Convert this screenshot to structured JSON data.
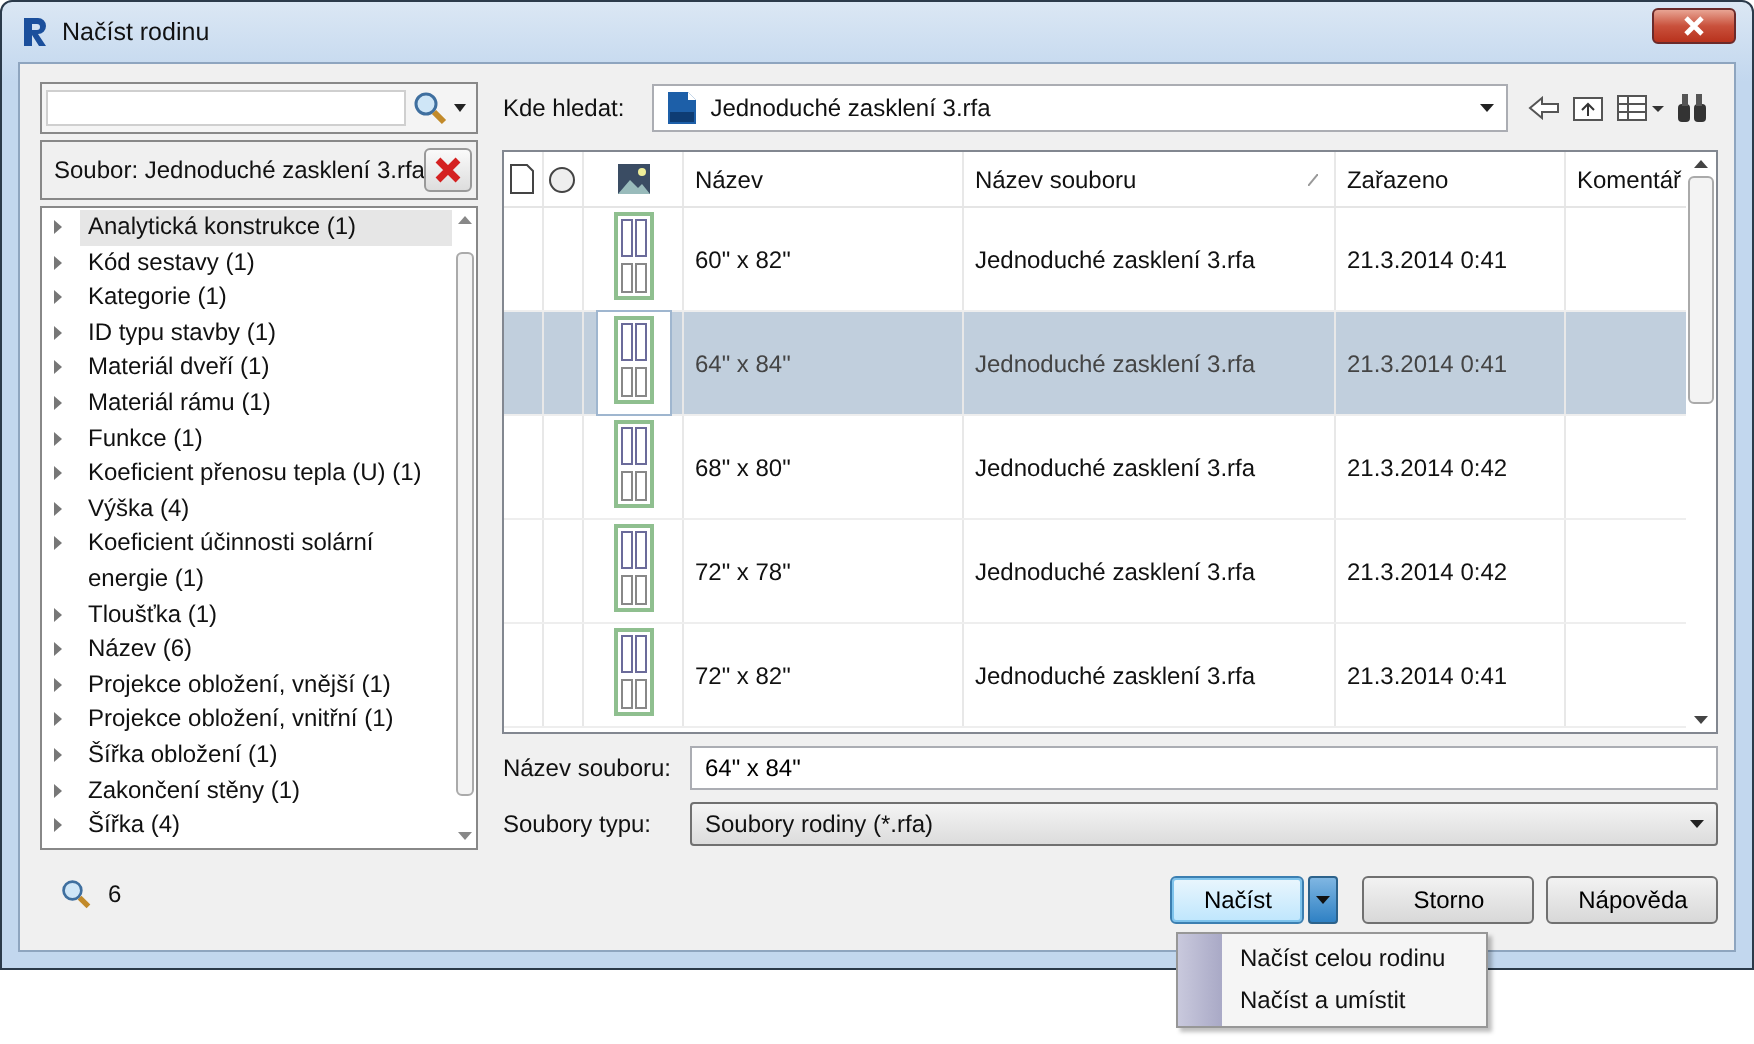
{
  "window": {
    "title": "Načíst rodinu"
  },
  "filter": {
    "label": "Soubor: Jednoduché zasklení 3.rfa"
  },
  "tree": [
    {
      "label": "Analytická konstrukce (1)",
      "selected": true
    },
    {
      "label": "Kód sestavy (1)",
      "selected": false
    },
    {
      "label": "Kategorie (1)",
      "selected": false
    },
    {
      "label": "ID typu stavby (1)",
      "selected": false
    },
    {
      "label": "Materiál dveří (1)",
      "selected": false
    },
    {
      "label": "Materiál rámu (1)",
      "selected": false
    },
    {
      "label": "Funkce (1)",
      "selected": false
    },
    {
      "label": "Koeficient přenosu tepla (U) (1)",
      "selected": false
    },
    {
      "label": "Výška (4)",
      "selected": false
    },
    {
      "label": "Koeficient účinnosti solární energie (1)",
      "selected": false
    },
    {
      "label": "Tloušťka (1)",
      "selected": false
    },
    {
      "label": "Název (6)",
      "selected": false
    },
    {
      "label": "Projekce obložení, vnější (1)",
      "selected": false
    },
    {
      "label": "Projekce obložení, vnitřní (1)",
      "selected": false
    },
    {
      "label": "Šířka obložení (1)",
      "selected": false
    },
    {
      "label": "Zakončení stěny (1)",
      "selected": false
    },
    {
      "label": "Šířka (4)",
      "selected": false
    }
  ],
  "result_count": "6",
  "look_in": {
    "label": "Kde hledat:",
    "value": "Jednoduché zasklení 3.rfa"
  },
  "table": {
    "columns": [
      "Název",
      "Název souboru",
      "Zařazeno",
      "Komentář"
    ],
    "rows": [
      {
        "name": "60\" x 82\"",
        "file": "Jednoduché zasklení 3.rfa",
        "date": "21.3.2014 0:41",
        "selected": false
      },
      {
        "name": "64\" x 84\"",
        "file": "Jednoduché zasklení 3.rfa",
        "date": "21.3.2014 0:41",
        "selected": true
      },
      {
        "name": "68\" x 80\"",
        "file": "Jednoduché zasklení 3.rfa",
        "date": "21.3.2014 0:42",
        "selected": false
      },
      {
        "name": "72\" x 78\"",
        "file": "Jednoduché zasklení 3.rfa",
        "date": "21.3.2014 0:42",
        "selected": false
      },
      {
        "name": "72\" x 82\"",
        "file": "Jednoduché zasklení 3.rfa",
        "date": "21.3.2014 0:41",
        "selected": false
      }
    ]
  },
  "file_name": {
    "label": "Název souboru:",
    "value": "64\" x 84\""
  },
  "file_type": {
    "label": "Soubory typu:",
    "value": "Soubory rodiny (*.rfa)"
  },
  "buttons": [
    {
      "label": "Načíst",
      "kind": "split"
    },
    {
      "label": "Storno",
      "kind": "plain"
    },
    {
      "label": "Nápověda",
      "kind": "plain"
    }
  ],
  "menu": [
    "Načíst celou rodinu",
    "Načíst a umístit"
  ]
}
